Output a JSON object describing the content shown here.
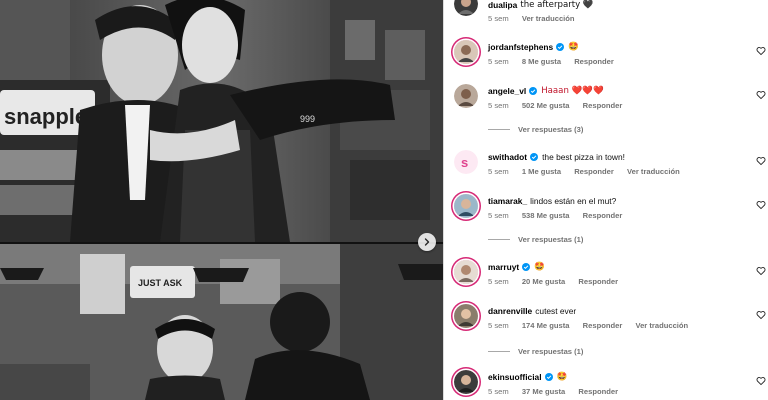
{
  "post": {
    "author": "dualipa",
    "caption": "the afterparty 🖤",
    "time": "5 sem",
    "translate": "Ver traducción"
  },
  "photos": {
    "top_sign": "snapple",
    "top_sleeve_text": "999",
    "bottom_sign": "JUST ASK"
  },
  "labels": {
    "likes_suffix": "Me gusta",
    "reply": "Responder",
    "translate": "Ver traducción"
  },
  "comments": [
    {
      "user": "jordanfstephens",
      "verified": true,
      "text": "🤩",
      "time": "5 sem",
      "likes": "8 Me gusta",
      "reply": "Responder"
    },
    {
      "user": "angele_vl",
      "verified": true,
      "text": "Haaan ❤️❤️❤️",
      "time": "5 sem",
      "likes": "502 Me gusta",
      "reply": "Responder",
      "replies": "Ver respuestas (3)"
    },
    {
      "user": "swithadot",
      "verified": true,
      "text": "the best pizza in town!",
      "time": "5 sem",
      "likes": "1 Me gusta",
      "reply": "Responder",
      "translate": "Ver traducción"
    },
    {
      "user": "tiamarak_",
      "verified": false,
      "text": "lindos están en el mut?",
      "time": "5 sem",
      "likes": "538 Me gusta",
      "reply": "Responder",
      "replies": "Ver respuestas (1)"
    },
    {
      "user": "marruyt",
      "verified": true,
      "text": "🤩",
      "time": "5 sem",
      "likes": "20 Me gusta",
      "reply": "Responder"
    },
    {
      "user": "danrenville",
      "verified": false,
      "text": "cutest ever",
      "time": "5 sem",
      "likes": "174 Me gusta",
      "reply": "Responder",
      "translate": "Ver traducción",
      "replies": "Ver respuestas (1)"
    },
    {
      "user": "ekinsuofficial",
      "verified": true,
      "text": "🤩",
      "time": "5 sem",
      "likes": "37 Me gusta",
      "reply": "Responder"
    }
  ],
  "colors": {
    "verified": "#0095f6",
    "story_ring": "#d62976",
    "meta_text": "#737373"
  }
}
